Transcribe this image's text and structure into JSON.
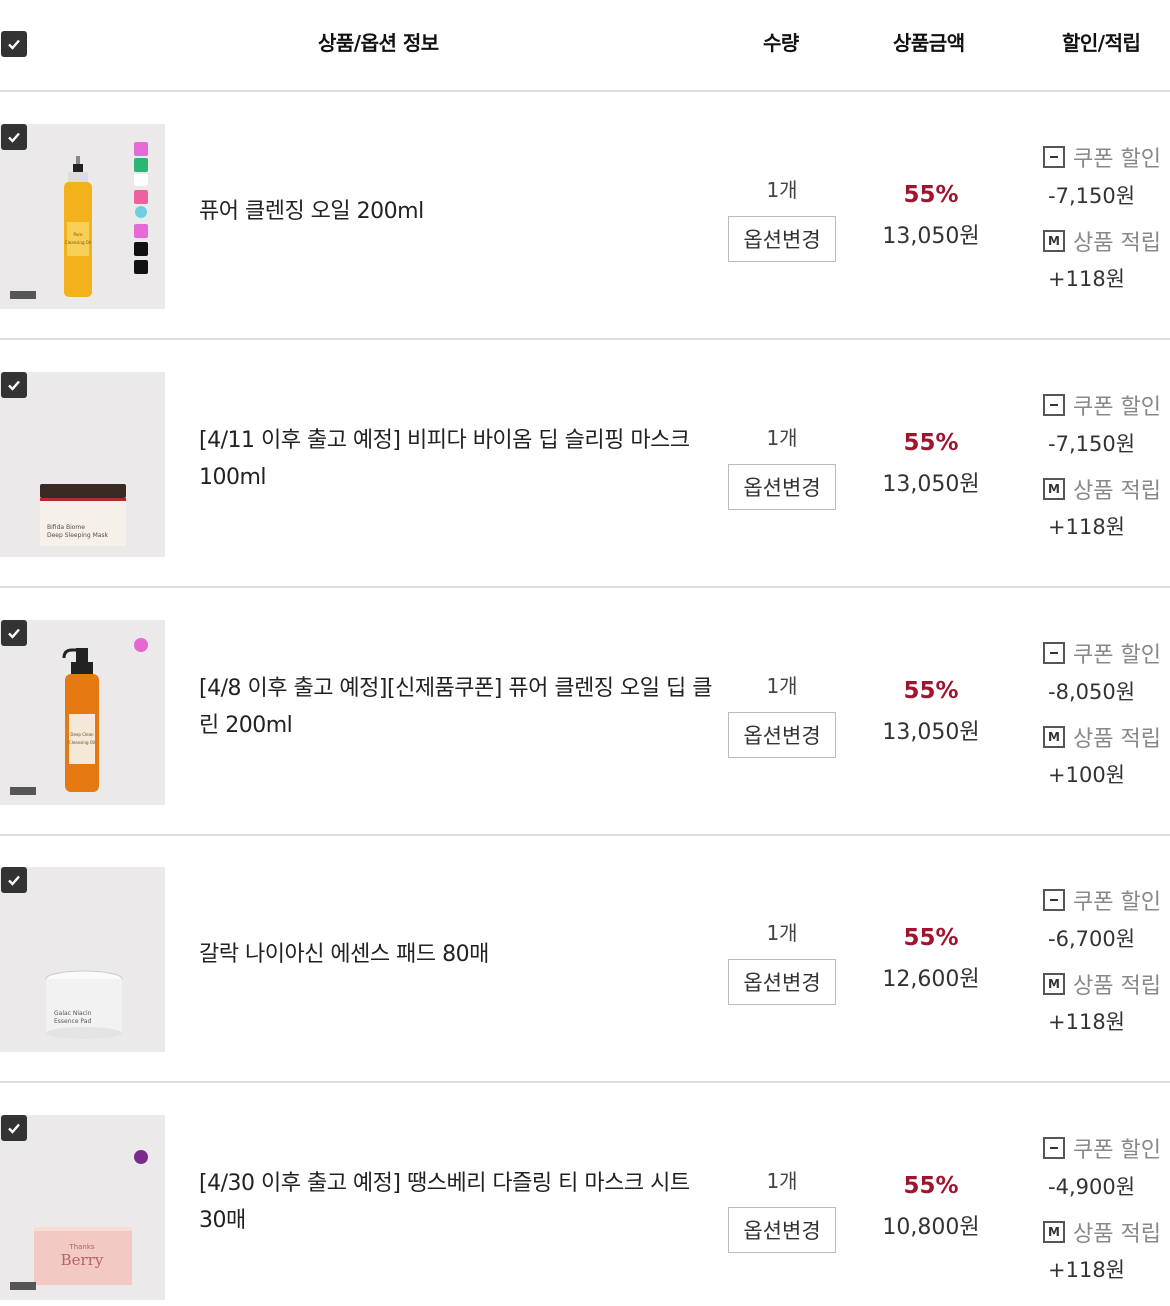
{
  "header": {
    "product_info": "상품/옵션 정보",
    "quantity": "수량",
    "amount": "상품금액",
    "discount": "할인/적립"
  },
  "items": [
    {
      "name": "퓨어 클렌징 오일 200ml",
      "qty": "1개",
      "option_btn": "옵션변경",
      "rate": "55%",
      "price": "13,050원",
      "coupon_label": "쿠폰 할인",
      "coupon_value": "-7,150원",
      "point_label": "상품 적립",
      "point_value": "+118원"
    },
    {
      "name": "[4/11 이후 출고 예정] 비피다 바이옴 딥 슬리핑 마스크 100ml",
      "qty": "1개",
      "option_btn": "옵션변경",
      "rate": "55%",
      "price": "13,050원",
      "coupon_label": "쿠폰 할인",
      "coupon_value": "-7,150원",
      "point_label": "상품 적립",
      "point_value": "+118원"
    },
    {
      "name": "[4/8 이후 출고 예정][신제품쿠폰] 퓨어 클렌징 오일 딥 클린 200ml",
      "qty": "1개",
      "option_btn": "옵션변경",
      "rate": "55%",
      "price": "13,050원",
      "coupon_label": "쿠폰 할인",
      "coupon_value": "-8,050원",
      "point_label": "상품 적립",
      "point_value": "+100원"
    },
    {
      "name": "갈락 나이아신 에센스 패드 80매",
      "qty": "1개",
      "option_btn": "옵션변경",
      "rate": "55%",
      "price": "12,600원",
      "coupon_label": "쿠폰 할인",
      "coupon_value": "-6,700원",
      "point_label": "상품 적립",
      "point_value": "+118원"
    },
    {
      "name": "[4/30 이후 출고 예정] 땡스베리 다즐링 티 마스크 시트 30매",
      "qty": "1개",
      "option_btn": "옵션변경",
      "rate": "55%",
      "price": "10,800원",
      "coupon_label": "쿠폰 할인",
      "coupon_value": "-4,900원",
      "point_label": "상품 적립",
      "point_value": "+118원"
    }
  ],
  "product_images": [
    {
      "lines": [
        "Pure",
        "Cleansing Oil"
      ]
    },
    {
      "lines": [
        "Bifida Biome",
        "Deep Sleeping Mask"
      ]
    },
    {
      "lines": [
        "Deep Clean",
        "Cleansing Oil"
      ]
    },
    {
      "lines": [
        "Galac Niacin",
        "Essence Pad"
      ]
    },
    {
      "lines": [
        "Thanks",
        "Berry"
      ]
    }
  ],
  "icons": {
    "checkbox": "check-icon",
    "coupon": "minus-box-icon",
    "point": "m-box-icon",
    "point_letter": "M"
  },
  "colors": {
    "accent": "#a0152d",
    "checkbox": "#333333"
  }
}
